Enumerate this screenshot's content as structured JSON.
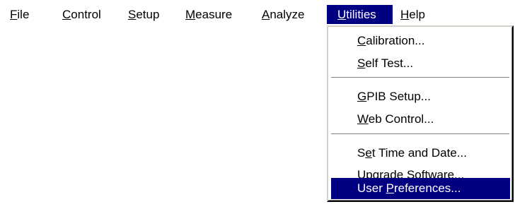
{
  "menubar": {
    "file": {
      "mnemonic": "F",
      "rest": "ile"
    },
    "control": {
      "mnemonic": "C",
      "rest": "ontrol"
    },
    "setup": {
      "mnemonic": "S",
      "rest": "etup"
    },
    "measure": {
      "mnemonic": "M",
      "rest": "easure"
    },
    "analyze": {
      "mnemonic": "A",
      "rest": "nalyze"
    },
    "utilities": {
      "mnemonic": "U",
      "rest": "tilities"
    },
    "help": {
      "mnemonic": "H",
      "rest": "elp"
    }
  },
  "utilities_menu": {
    "calibration": {
      "pre": "",
      "mnemonic": "C",
      "rest": "alibration..."
    },
    "self_test": {
      "pre": "",
      "mnemonic": "S",
      "rest": "elf Test..."
    },
    "gpib_setup": {
      "pre": "",
      "mnemonic": "G",
      "rest": "PIB Setup..."
    },
    "web_control": {
      "pre": "",
      "mnemonic": "W",
      "rest": "eb Control..."
    },
    "set_time_date": {
      "pre": "S",
      "mnemonic": "e",
      "rest": "t Time and Date..."
    },
    "upgrade_software": {
      "pre": "",
      "mnemonic": "U",
      "rest": "pgrade Software..."
    },
    "user_preferences": {
      "pre": "User ",
      "mnemonic": "P",
      "rest": "references..."
    }
  },
  "colors": {
    "highlight": "#000080",
    "highlight_text": "#ffffff",
    "menu_background": "#ffffff"
  }
}
